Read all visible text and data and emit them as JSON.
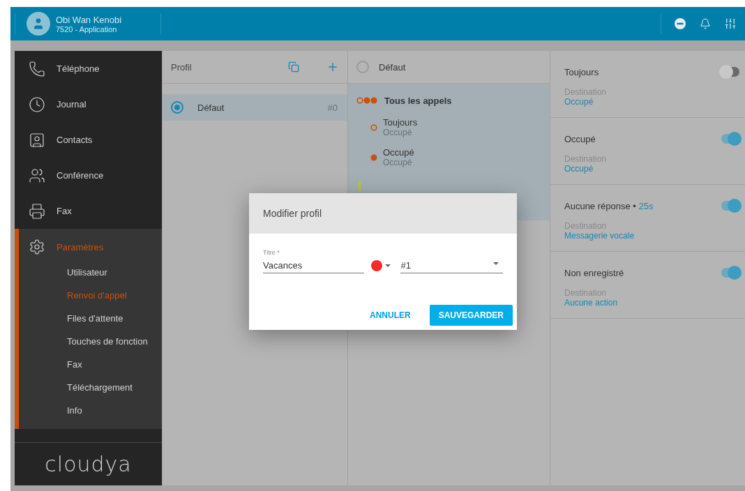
{
  "header": {
    "user_name": "Obi Wan Kenobi",
    "user_line": "7520 - Application"
  },
  "sidebar": {
    "items": [
      {
        "label": "Téléphone",
        "kind": "phone",
        "selected": false
      },
      {
        "label": "Journal",
        "kind": "clock",
        "selected": false
      },
      {
        "label": "Contacts",
        "kind": "contact",
        "selected": false
      },
      {
        "label": "Conférence",
        "kind": "conference",
        "selected": false
      },
      {
        "label": "Fax",
        "kind": "fax",
        "selected": false
      },
      {
        "label": "Paramètres",
        "kind": "settings",
        "selected": true,
        "children": [
          {
            "label": "Utilisateur",
            "selected": false
          },
          {
            "label": "Renvoi d'appel",
            "selected": true
          },
          {
            "label": "Files d'attente",
            "selected": false
          },
          {
            "label": "Touches de fonction",
            "selected": false
          },
          {
            "label": "Fax",
            "selected": false
          },
          {
            "label": "Téléchargement",
            "selected": false
          },
          {
            "label": "Info",
            "selected": false
          }
        ]
      }
    ],
    "logo": "cloudya"
  },
  "profiles": {
    "title": "Profil",
    "rows": [
      {
        "name": "Défaut",
        "number": "#0",
        "selected": true
      }
    ]
  },
  "rules": {
    "profile": {
      "name": "Défaut",
      "selected": false
    },
    "heading": "Tous les appels",
    "items": [
      {
        "title": "Toujours",
        "subtitle": "Occupé",
        "kind": "ring"
      },
      {
        "title": "Occupé",
        "subtitle": "Occupé",
        "kind": "dot"
      }
    ]
  },
  "settings": [
    {
      "title": "Toujours",
      "on": false,
      "dest_label": "Destination",
      "dest": "Occupé"
    },
    {
      "title": "Occupé",
      "on": true,
      "dest_label": "Destination",
      "dest": "Occupé"
    },
    {
      "title": "Aucune réponse •",
      "delay": "25s",
      "on": true,
      "dest_label": "Destination",
      "dest": "Messagerie vocale"
    },
    {
      "title": "Non enregistré",
      "on": true,
      "dest_label": "Destination",
      "dest": "Aucune action"
    }
  ],
  "dialog": {
    "title": "Modifier profil",
    "field_label": "Titre *",
    "field_value": "Vacances",
    "color": "#f52a2a",
    "number": "#1",
    "buttons": [
      {
        "label": "ANNULER",
        "kind": "text"
      },
      {
        "label": "SAUVEGARDER",
        "kind": "primary"
      }
    ]
  }
}
